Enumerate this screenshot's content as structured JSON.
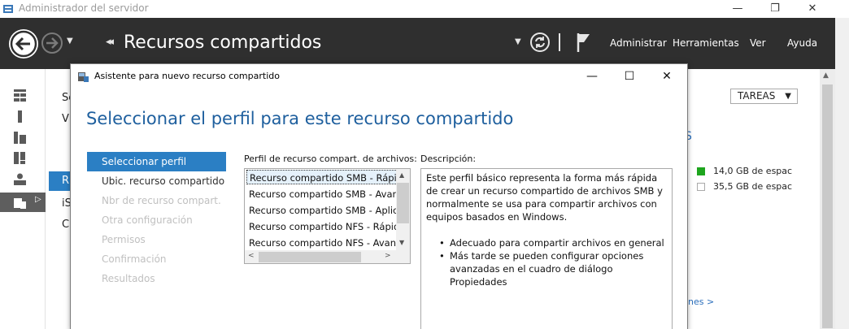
{
  "window": {
    "title": "Administrador del servidor",
    "min_label": "—",
    "max_label": "❐",
    "close_label": "✕"
  },
  "command_bar": {
    "breadcrumb_arrows": "◂◂",
    "page_title": "Recursos compartidos",
    "menu": [
      "Administrar",
      "Herramientas",
      "Ver",
      "Ayuda"
    ]
  },
  "background": {
    "left_text_1": "Se",
    "left_text_2": "V",
    "left_text_3": "R",
    "left_text_4": "iS",
    "left_text_5": "C",
    "tasks_label": "TAREAS",
    "legend": [
      {
        "label": "14,0 GB de espac",
        "color": "#1ea51e",
        "filled": true
      },
      {
        "label": "35,5 GB de espac",
        "color": "#ffffff",
        "filled": false
      }
    ],
    "more_link": "nes >",
    "partial_s": "S"
  },
  "wizard": {
    "title": "Asistente para nuevo recurso compartido",
    "min_label": "—",
    "max_label": "☐",
    "close_label": "✕",
    "heading": "Seleccionar el perfil para este recurso compartido",
    "steps": [
      {
        "label": "Seleccionar perfil",
        "state": "active"
      },
      {
        "label": "Ubic. recurso compartido",
        "state": "enabled"
      },
      {
        "label": "Nbr de recurso compart.",
        "state": "disabled"
      },
      {
        "label": "Otra configuración",
        "state": "disabled"
      },
      {
        "label": "Permisos",
        "state": "disabled"
      },
      {
        "label": "Confirmación",
        "state": "disabled"
      },
      {
        "label": "Resultados",
        "state": "disabled"
      }
    ],
    "profile_label": "Perfil de recurso compart. de archivos:",
    "profiles": [
      "Recurso compartido SMB - Rápido",
      "Recurso compartido SMB - Avanzado",
      "Recurso compartido SMB - Aplicaciones",
      "Recurso compartido NFS - Rápido",
      "Recurso compartido NFS - Avanzado"
    ],
    "selected_profile_index": 0,
    "description_label": "Descripción:",
    "description": "Este perfil básico representa la forma más rápida de crear un recurso compartido de archivos SMB y normalmente se usa para compartir archivos con equipos basados en Windows.",
    "bullets": [
      "Adecuado para compartir archivos en general",
      "Más tarde se pueden configurar opciones avanzadas en el cuadro de diálogo Propiedades"
    ]
  }
}
